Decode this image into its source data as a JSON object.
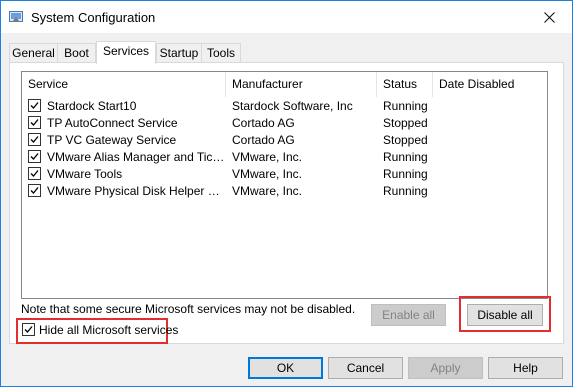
{
  "window": {
    "title": "System Configuration",
    "close_glyph": "✕"
  },
  "tabs": [
    {
      "label": "General",
      "active": false
    },
    {
      "label": "Boot",
      "active": false
    },
    {
      "label": "Services",
      "active": true
    },
    {
      "label": "Startup",
      "active": false
    },
    {
      "label": "Tools",
      "active": false
    }
  ],
  "services_table": {
    "columns": [
      "Service",
      "Manufacturer",
      "Status",
      "Date Disabled"
    ],
    "rows": [
      {
        "checked": true,
        "service": "Stardock Start10",
        "manufacturer": "Stardock Software, Inc",
        "status": "Running",
        "date_disabled": ""
      },
      {
        "checked": true,
        "service": "TP AutoConnect Service",
        "manufacturer": "Cortado AG",
        "status": "Stopped",
        "date_disabled": ""
      },
      {
        "checked": true,
        "service": "TP VC Gateway Service",
        "manufacturer": "Cortado AG",
        "status": "Stopped",
        "date_disabled": ""
      },
      {
        "checked": true,
        "service": "VMware Alias Manager and Ticke...",
        "manufacturer": "VMware, Inc.",
        "status": "Running",
        "date_disabled": ""
      },
      {
        "checked": true,
        "service": "VMware Tools",
        "manufacturer": "VMware, Inc.",
        "status": "Running",
        "date_disabled": ""
      },
      {
        "checked": true,
        "service": "VMware Physical Disk Helper Ser...",
        "manufacturer": "VMware, Inc.",
        "status": "Running",
        "date_disabled": ""
      }
    ]
  },
  "note": "Note that some secure Microsoft services may not be disabled.",
  "hide_ms": {
    "label": "Hide all Microsoft services",
    "checked": true
  },
  "buttons": {
    "enable_all": "Enable all",
    "disable_all": "Disable all",
    "ok": "OK",
    "cancel": "Cancel",
    "apply": "Apply",
    "help": "Help"
  },
  "colors": {
    "highlight": "#e52d2d",
    "accent": "#0078d7"
  },
  "icons": {
    "app": "system-configuration-icon",
    "close": "close-icon",
    "check": "checkmark-icon"
  }
}
